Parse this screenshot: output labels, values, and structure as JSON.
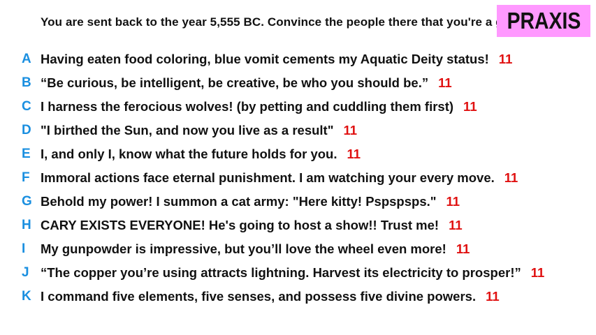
{
  "prompt": "You are sent back to the year 5,555 BC. Convince the people there that you're a god.",
  "logo": "PRAXIS",
  "colors": {
    "letter": "#1a8fe0",
    "score": "#e01010",
    "logo_bg": "#ff99ff"
  },
  "answers": [
    {
      "letter": "A",
      "text": "Having eaten food coloring, blue vomit cements my Aquatic Deity status!",
      "score": "11"
    },
    {
      "letter": "B",
      "text": "“Be curious, be intelligent, be creative, be who you should be.”",
      "score": "11"
    },
    {
      "letter": "C",
      "text": "I harness the ferocious wolves! (by petting and cuddling them first)",
      "score": "11"
    },
    {
      "letter": "D",
      "text": "\"I birthed the Sun, and now you live as a result\"",
      "score": "11"
    },
    {
      "letter": "E",
      "text": "I, and only I, know what the future holds for you.",
      "score": "11"
    },
    {
      "letter": "F",
      "text": "Immoral actions face eternal punishment. I am watching your every move.",
      "score": "11"
    },
    {
      "letter": "G",
      "text": "Behold my power! I summon a cat army: \"Here kitty! Pspspsps.\"",
      "score": "11"
    },
    {
      "letter": "H",
      "text": "CARY EXISTS EVERYONE! He's going to host a show!! Trust me!",
      "score": "11"
    },
    {
      "letter": "I",
      "text": "My gunpowder is impressive, but you’ll love the wheel even more!",
      "score": "11"
    },
    {
      "letter": "J",
      "text": "“The copper you’re using attracts lightning. Harvest its electricity to prosper!”",
      "score": "11"
    },
    {
      "letter": "K",
      "text": "I command five elements, five senses, and possess five divine powers.",
      "score": "11"
    }
  ]
}
